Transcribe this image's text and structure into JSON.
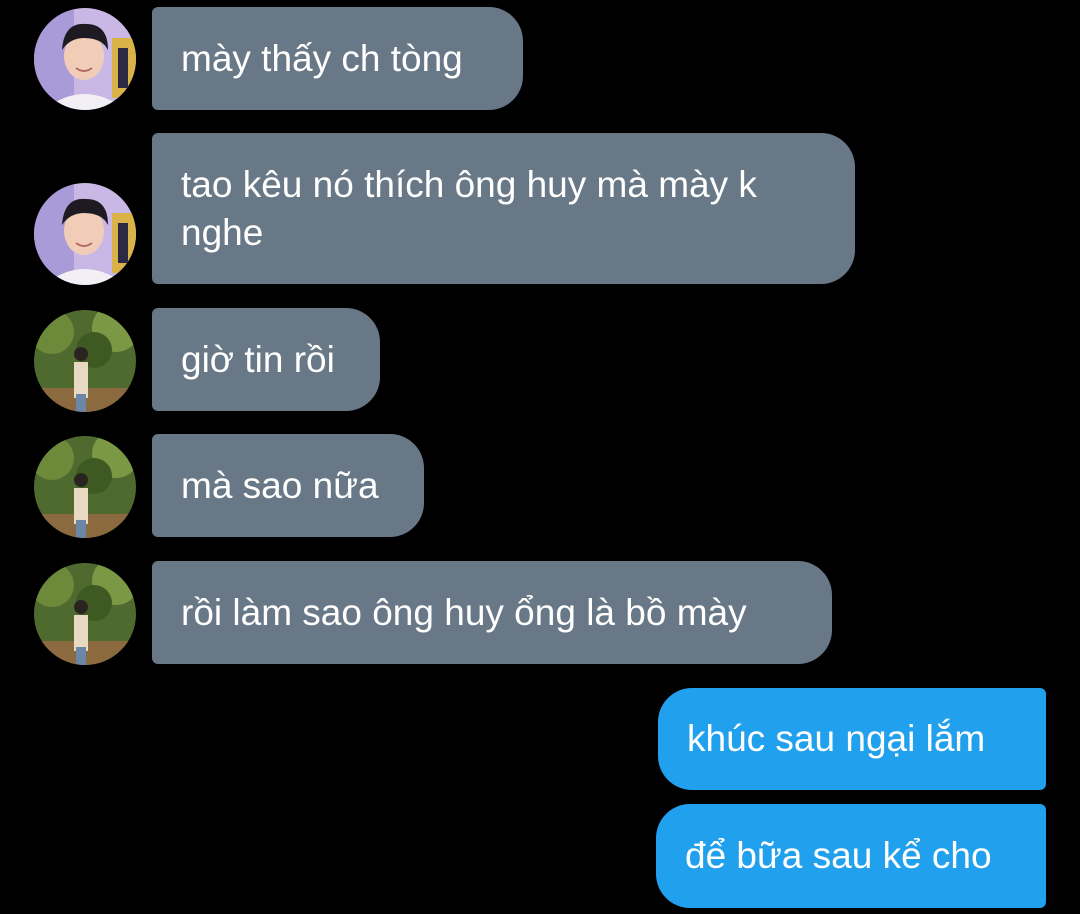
{
  "conversation": {
    "messages": [
      {
        "sender": "friend-a",
        "direction": "received",
        "text": "mày thấy ch tòng"
      },
      {
        "sender": "friend-a",
        "direction": "received",
        "text": "tao kêu nó thích ông huy mà mày k\nnghe"
      },
      {
        "sender": "friend-b",
        "direction": "received",
        "text": "giờ tin rồi"
      },
      {
        "sender": "friend-b",
        "direction": "received",
        "text": "mà sao nữa"
      },
      {
        "sender": "friend-b",
        "direction": "received",
        "text": "rồi làm sao ông huy ổng là bồ mày"
      },
      {
        "sender": "me",
        "direction": "sent",
        "text": "khúc sau ngại lắm"
      },
      {
        "sender": "me",
        "direction": "sent",
        "text": "để bữa sau kể cho"
      }
    ]
  },
  "colors": {
    "background": "#000000",
    "received_bubble": "#687886",
    "sent_bubble": "#21a0ed",
    "text": "#ffffff"
  },
  "avatars": {
    "friend-a": "portrait-photo-indoor",
    "friend-b": "portrait-photo-outdoor-trees"
  }
}
